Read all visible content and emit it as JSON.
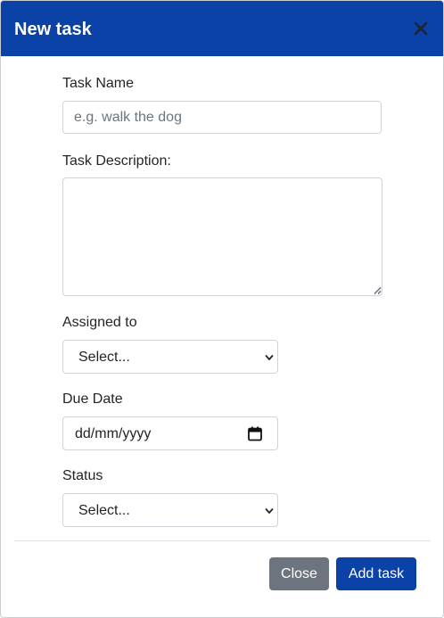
{
  "modal": {
    "title": "New task",
    "close_icon": "close-icon"
  },
  "form": {
    "task_name": {
      "label": "Task Name",
      "placeholder": "e.g. walk the dog",
      "value": ""
    },
    "task_description": {
      "label": "Task Description:",
      "value": ""
    },
    "assigned_to": {
      "label": "Assigned to",
      "selected": "Select..."
    },
    "due_date": {
      "label": "Due Date",
      "value": "dd/mm/yyyy",
      "icon": "calendar-icon"
    },
    "status": {
      "label": "Status",
      "selected": "Select..."
    }
  },
  "footer": {
    "close_label": "Close",
    "add_label": "Add task"
  },
  "colors": {
    "header_bg": "#0a42a8",
    "primary_button": "#0a42a8",
    "secondary_button": "#6c757d",
    "border": "#ced4da"
  }
}
